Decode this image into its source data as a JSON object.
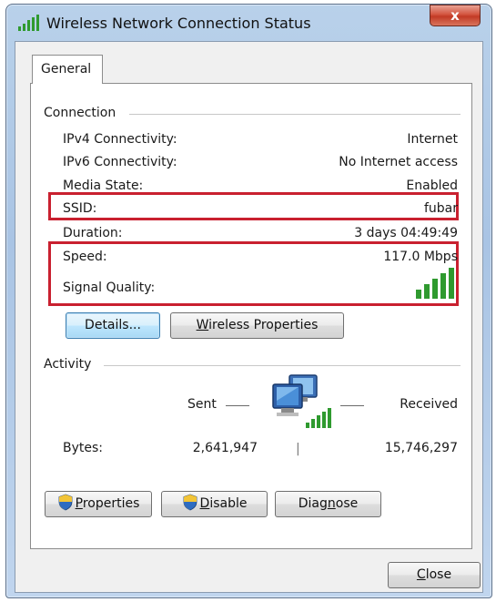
{
  "window": {
    "title": "Wireless Network Connection Status",
    "close_label": "x"
  },
  "tabs": [
    {
      "label": "General"
    }
  ],
  "connection": {
    "header": "Connection",
    "rows": [
      {
        "label": "IPv4 Connectivity:",
        "value": "Internet"
      },
      {
        "label": "IPv6 Connectivity:",
        "value": "No Internet access"
      },
      {
        "label": "Media State:",
        "value": "Enabled"
      },
      {
        "label": "SSID:",
        "value": "fubar"
      },
      {
        "label": "Duration:",
        "value": "3 days 04:49:49"
      },
      {
        "label": "Speed:",
        "value": "117.0 Mbps"
      }
    ],
    "signal_quality_label": "Signal Quality:",
    "signal_bars": 5,
    "signal_color": "#2f9a2f"
  },
  "buttons": {
    "details": "Details...",
    "wireless_properties": "Wireless Properties",
    "properties": "Properties",
    "disable": "Disable",
    "diagnose": "Diagnose",
    "close": "Close"
  },
  "activity": {
    "header": "Activity",
    "sent_label": "Sent",
    "received_label": "Received",
    "bytes_label": "Bytes:",
    "bytes_sent": "2,641,947",
    "bytes_received": "15,746,297",
    "separator": "|"
  },
  "colors": {
    "highlight": "#c9202f",
    "window_frame": "#b9d1ea",
    "panel_bg": "#f0f0f0"
  },
  "icons": [
    "signal-strength-icon",
    "network-computers-icon",
    "shield-icon"
  ]
}
